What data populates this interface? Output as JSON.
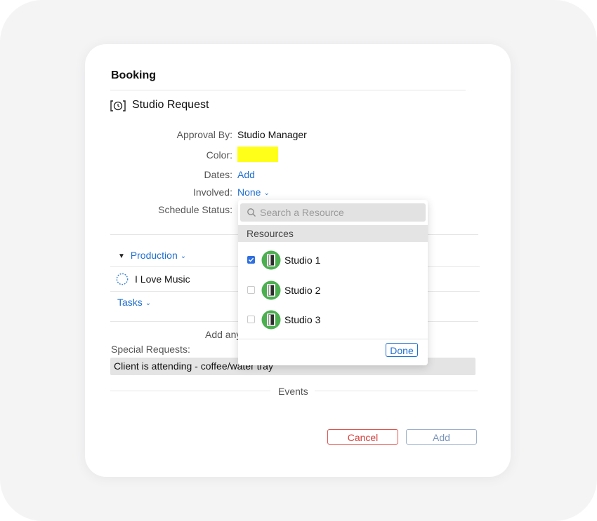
{
  "dialog": {
    "title": "Booking",
    "request_title": "Studio Request",
    "fields": {
      "approval_label": "Approval By:",
      "approval_value": "Studio Manager",
      "color_label": "Color:",
      "color_value": "#ffff1a",
      "dates_label": "Dates:",
      "dates_value": "Add",
      "involved_label": "Involved:",
      "involved_value": "None",
      "schedule_label": "Schedule Status:"
    },
    "production_label": "Production",
    "music_label": "I Love Music",
    "tasks_label": "Tasks",
    "add_any_text": "Add any",
    "special_requests_label": "Special Requests:",
    "special_requests_value": "Client is attending - coffee/water tray",
    "events_label": "Events",
    "cancel_label": "Cancel",
    "add_label": "Add"
  },
  "dropdown": {
    "search_placeholder": "Search a Resource",
    "section_title": "Resources",
    "items": [
      {
        "label": "Studio 1",
        "checked": true
      },
      {
        "label": "Studio 2",
        "checked": false
      },
      {
        "label": "Studio 3",
        "checked": false
      }
    ],
    "done_label": "Done"
  },
  "colors": {
    "accent": "#1f6fd0",
    "cancel": "#d63d3a",
    "checkbox": "#2f6fe0",
    "avatar": "#4caf50"
  }
}
